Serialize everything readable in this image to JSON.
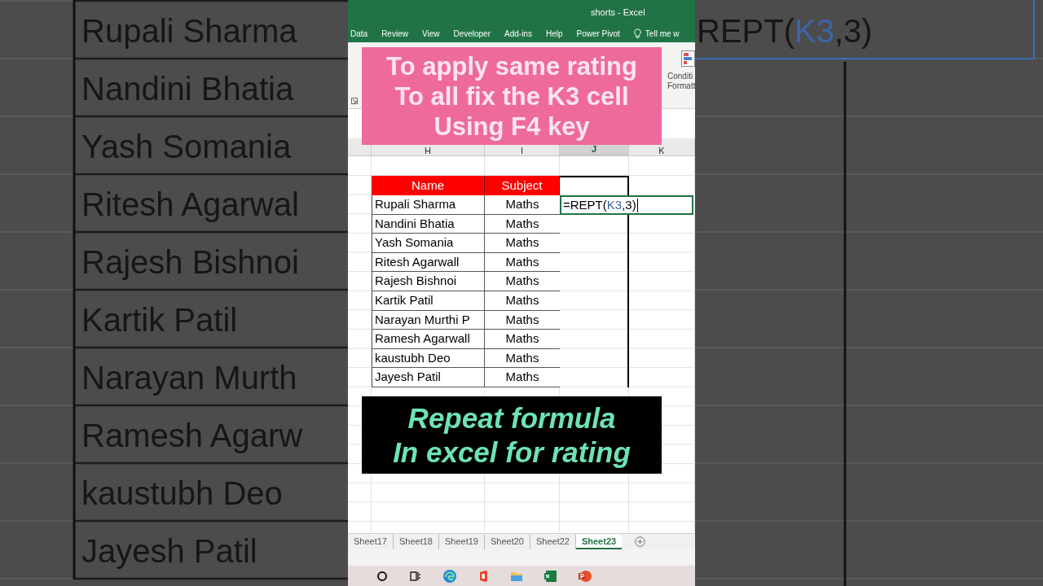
{
  "left_backdrop": {
    "names": [
      "Rupali Sharma",
      "Nandini Bhatia",
      "Yash Somania",
      "Ritesh Agarwal",
      "Rajesh Bishnoi",
      "Kartik Patil",
      "Narayan Murth",
      "Ramesh Agarw",
      "kaustubh Deo",
      "Jayesh Patil"
    ]
  },
  "right_backdrop": {
    "formula_parts": [
      {
        "text": "REPT(",
        "kind": "plain"
      },
      {
        "text": "K3",
        "kind": "ref"
      },
      {
        "text": ",3)",
        "kind": "plain"
      }
    ]
  },
  "window": {
    "title": "shorts  -  Excel"
  },
  "ribbon_tabs": [
    "Data",
    "Review",
    "View",
    "Developer",
    "Add-ins",
    "Help",
    "Power Pivot"
  ],
  "tell_me": "Tell me w",
  "ribbon": {
    "conditional_formatting": [
      "Conditi",
      "Formatt"
    ]
  },
  "column_headers": [
    {
      "label": "H",
      "selected": false
    },
    {
      "label": "I",
      "selected": false
    },
    {
      "label": "J",
      "selected": true
    },
    {
      "label": "K",
      "selected": false
    }
  ],
  "table": {
    "columns": [
      "Name",
      "Subject"
    ],
    "rows": [
      [
        "Rupali Sharma",
        "Maths"
      ],
      [
        "Nandini Bhatia",
        "Maths"
      ],
      [
        "Yash Somania",
        "Maths"
      ],
      [
        "Ritesh Agarwall",
        "Maths"
      ],
      [
        "Rajesh Bishnoi",
        "Maths"
      ],
      [
        "Kartik Patil",
        "Maths"
      ],
      [
        "Narayan Murthi P",
        "Maths"
      ],
      [
        "Ramesh Agarwall",
        "Maths"
      ],
      [
        "kaustubh Deo",
        "Maths"
      ],
      [
        "Jayesh Patil",
        "Maths"
      ]
    ]
  },
  "formula_cell": {
    "parts": [
      {
        "text": "=REPT(",
        "kind": "plain"
      },
      {
        "text": "K3",
        "kind": "ref"
      },
      {
        "text": ",3)",
        "kind": "plain"
      }
    ]
  },
  "top_caption": {
    "lines": [
      "To apply same rating",
      "To all fix the K3 cell",
      "Using F4 key"
    ]
  },
  "bottom_caption": {
    "lines": [
      "Repeat formula",
      "In excel for rating"
    ]
  },
  "sheet_tabs": [
    {
      "label": "Sheet17",
      "selected": false
    },
    {
      "label": "Sheet18",
      "selected": false
    },
    {
      "label": "Sheet19",
      "selected": false
    },
    {
      "label": "Sheet20",
      "selected": false
    },
    {
      "label": "Sheet22",
      "selected": false
    },
    {
      "label": "Sheet23",
      "selected": true
    }
  ]
}
